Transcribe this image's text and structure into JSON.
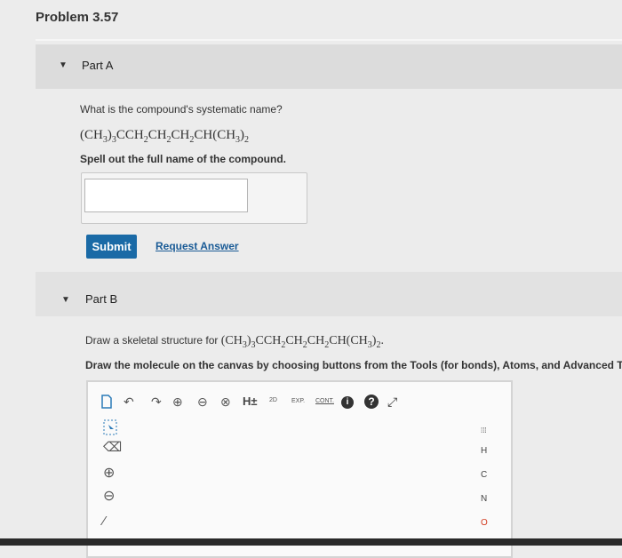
{
  "problem": {
    "title": "Problem 3.57"
  },
  "part_a": {
    "label": "Part A",
    "question": "What is the compound's systematic name?",
    "instruction": "Spell out the full name of the compound.",
    "answer_value": "",
    "submit_label": "Submit",
    "request_answer_label": "Request Answer"
  },
  "part_b": {
    "label": "Part B",
    "prompt": "Draw a skeletal structure for",
    "instruction": "Draw the molecule on the canvas by choosing buttons from the Tools (for bonds), Atoms, and Advanced Te"
  },
  "toolbar": {
    "h_label": "H±",
    "two_d_label": "2D",
    "exp_label": "EXP.",
    "cont_label": "CONT.",
    "info_label": "i",
    "help_label": "?"
  },
  "atoms": [
    "H",
    "C",
    "N",
    "O"
  ],
  "colors": {
    "submit_bg": "#1a6aa6",
    "link": "#1a5b96",
    "oxygen": "#d23a1e"
  }
}
